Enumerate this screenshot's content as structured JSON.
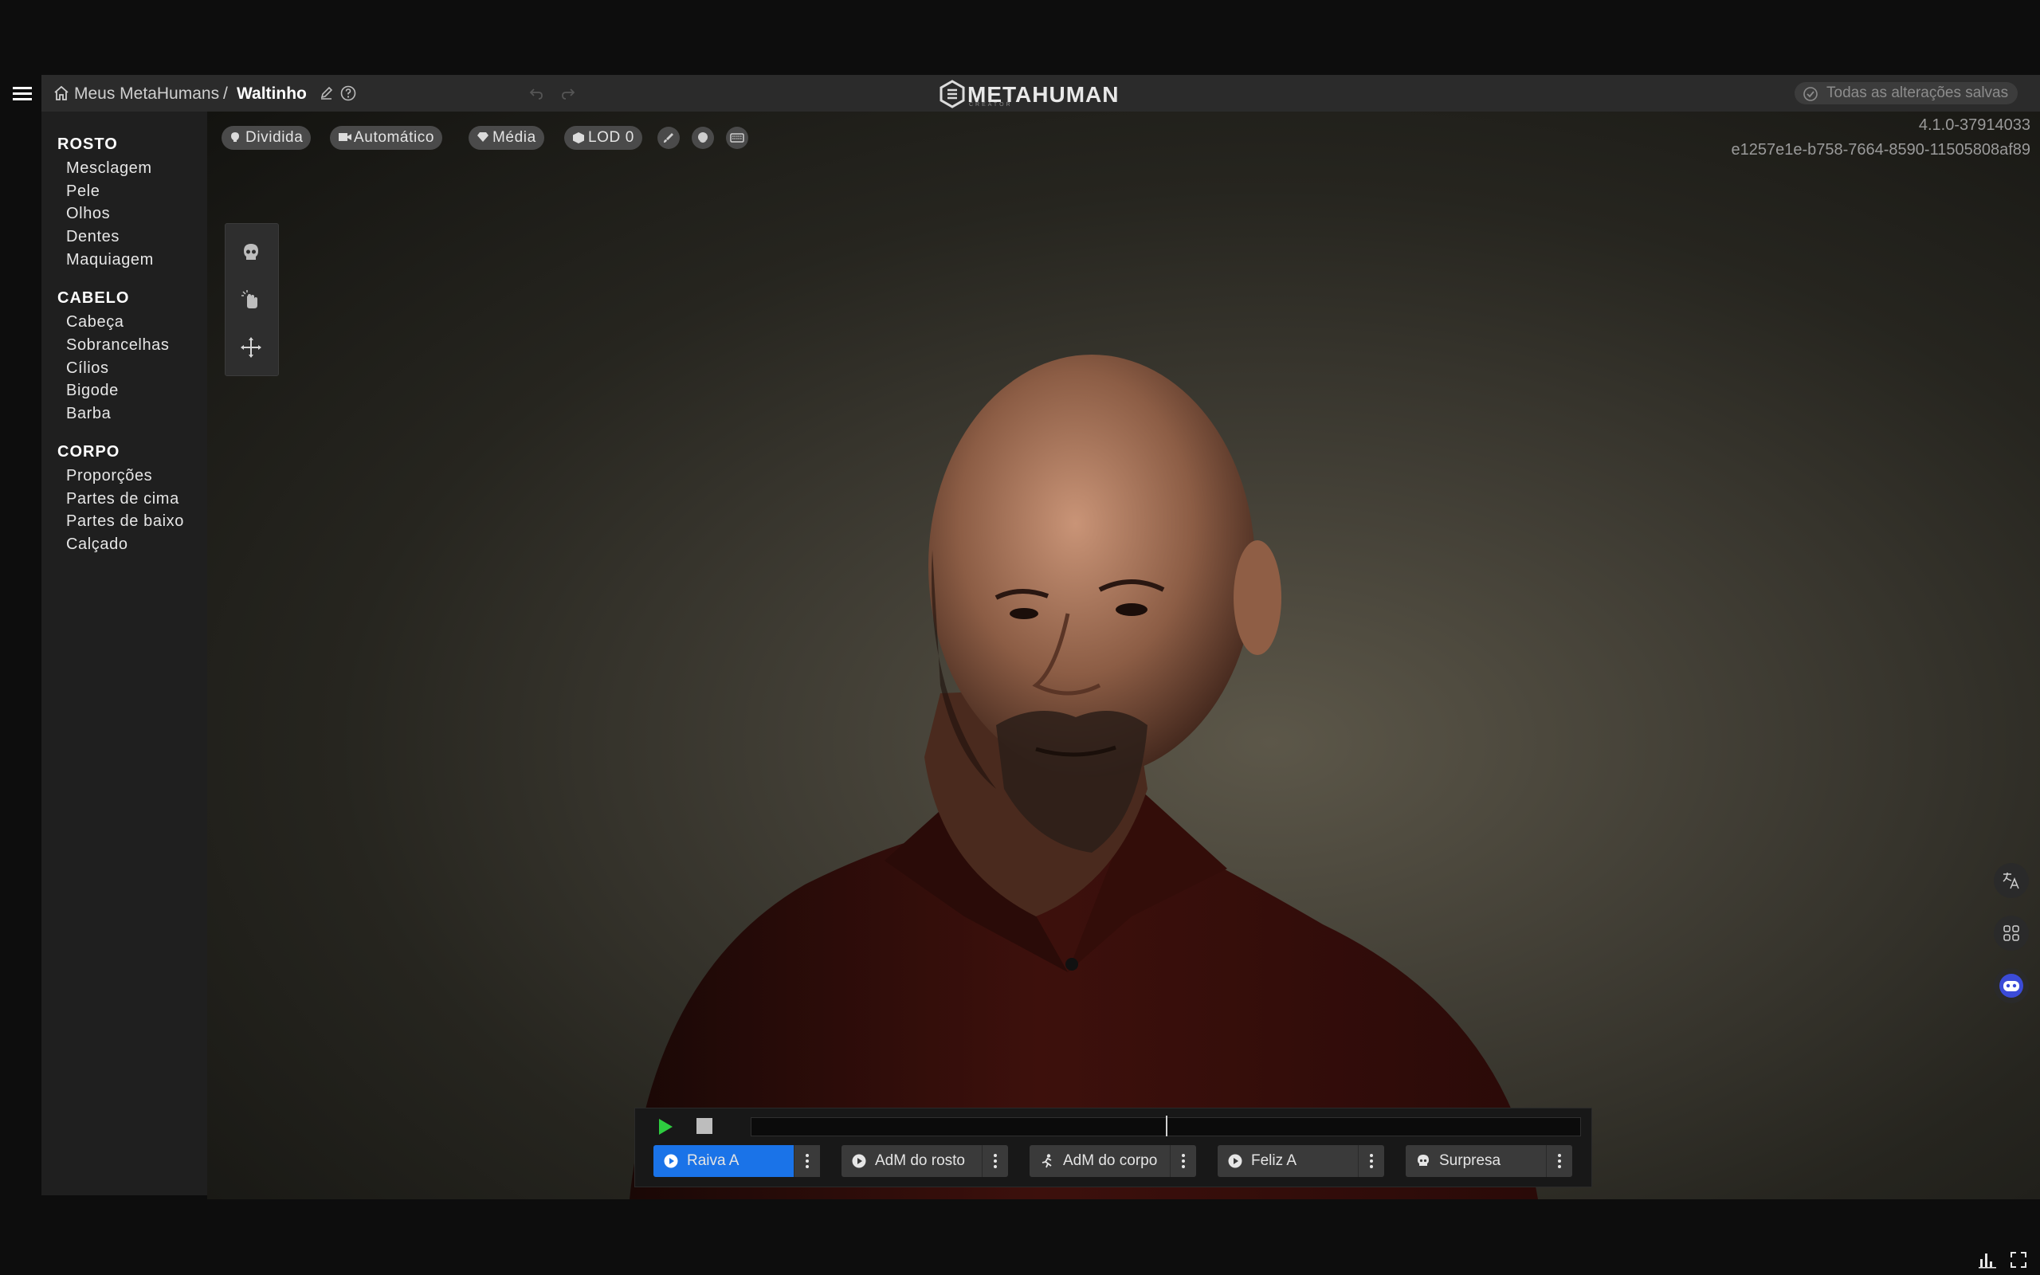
{
  "header": {
    "breadcrumb_root": "Meus MetaHumans",
    "breadcrumb_sep": "/",
    "breadcrumb_current": "Waltinho",
    "brand": "METAHUMAN",
    "brand_sub": "CREATOR",
    "save_status": "Todas as alterações salvas"
  },
  "sidebar": {
    "sections": [
      {
        "title": "ROSTO",
        "items": [
          "Mesclagem",
          "Pele",
          "Olhos",
          "Dentes",
          "Maquiagem"
        ]
      },
      {
        "title": "CABELO",
        "items": [
          "Cabeça",
          "Sobrancelhas",
          "Cílios",
          "Bigode",
          "Barba"
        ]
      },
      {
        "title": "CORPO",
        "items": [
          "Proporções",
          "Partes de cima",
          "Partes de baixo",
          "Calçado"
        ]
      }
    ]
  },
  "viewport": {
    "lighting": "Dividida",
    "camera": "Automático",
    "quality": "Média",
    "lod": "LOD 0",
    "version": "4.1.0-37914033",
    "session_id": "e1257e1e-b758-7664-8590-11505808af89"
  },
  "animations": [
    {
      "label": "Raiva A",
      "icon": "play-circle-icon",
      "active": true
    },
    {
      "label": "AdM do rosto",
      "icon": "play-circle-icon",
      "active": false
    },
    {
      "label": "AdM do corpo",
      "icon": "running-figure-icon",
      "active": false
    },
    {
      "label": "Feliz A",
      "icon": "play-circle-icon",
      "active": false
    },
    {
      "label": "Surpresa",
      "icon": "skull-icon",
      "active": false
    }
  ],
  "playback": {
    "position": 0.5
  },
  "colors": {
    "accent": "#1a73e8",
    "play": "#2ecc40",
    "avatar_bot": "#3b4bd8"
  }
}
